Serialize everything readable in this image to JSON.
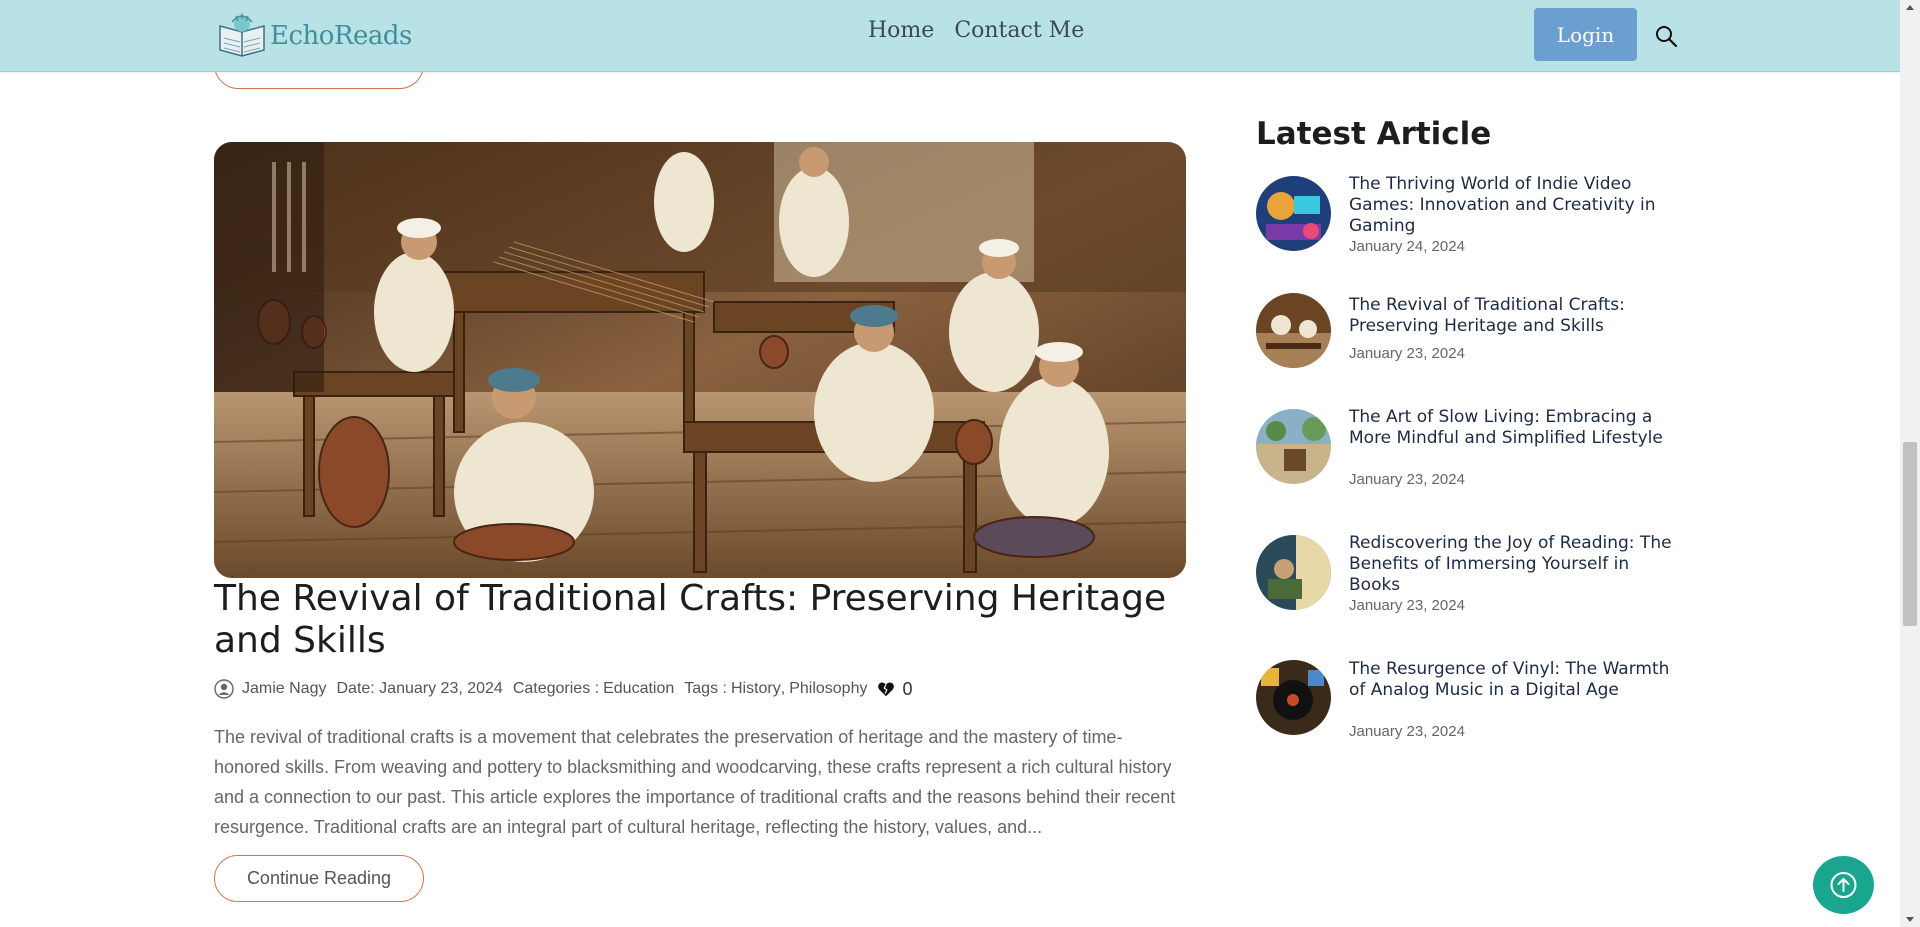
{
  "site": {
    "name": "EchoReads",
    "brand_color": "#3f8f9c"
  },
  "nav": {
    "items": [
      {
        "label": "Home"
      },
      {
        "label": "Contact Me"
      }
    ],
    "login_label": "Login",
    "accent": "#6a9fcf"
  },
  "article": {
    "title": "The Revival of Traditional Crafts: Preserving Heritage and Skills",
    "author": "Jamie Nagy",
    "date": "Date: January 23, 2024",
    "categories_prefix": "Categories :",
    "category": "Education",
    "tags_prefix": "Tags :",
    "tag1": "History",
    "tag_sep": ",",
    "tag2": "Philosophy",
    "likes": "0",
    "excerpt": "The revival of traditional crafts is a movement that celebrates the preservation of heritage and the mastery of time-honored skills. From weaving and pottery to blacksmithing and woodcarving, these crafts represent a rich cultural history and a connection to our past. This article explores the importance of traditional crafts and the reasons behind their recent resurgence. Traditional crafts are an integral part of cultural heritage, reflecting the history, values, and...",
    "continue_label": "Continue Reading"
  },
  "sidebar": {
    "title": "Latest Article",
    "items": [
      {
        "title": "The Thriving World of Indie Video Games: Innovation and Creativity in Gaming",
        "date": "January 24, 2024"
      },
      {
        "title": "The Revival of Traditional Crafts: Preserving Heritage and Skills",
        "date": "January 23, 2024"
      },
      {
        "title": "The Art of Slow Living: Embracing a More Mindful and Simplified Lifestyle",
        "date": "January 23, 2024"
      },
      {
        "title": "Rediscovering the Joy of Reading: The Benefits of Immersing Yourself in Books",
        "date": "January 23, 2024"
      },
      {
        "title": "The Resurgence of Vinyl: The Warmth of Analog Music in a Digital Age",
        "date": "January 23, 2024"
      }
    ]
  },
  "icons": {
    "logo": "book-logo-icon",
    "search": "search-icon",
    "user": "user-icon",
    "like": "heart-icon",
    "back_to_top": "arrow-up-icon"
  },
  "colors": {
    "header_bg": "#b9e2e6",
    "button_border": "#c97a4a",
    "back_to_top": "#1aa58f"
  }
}
